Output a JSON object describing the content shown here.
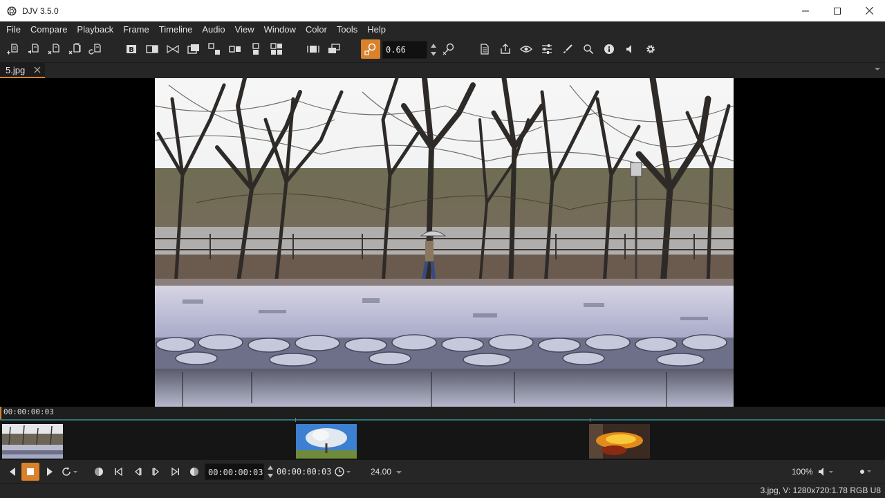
{
  "window": {
    "title": "DJV 3.5.0"
  },
  "menu": [
    "File",
    "Compare",
    "Playback",
    "Frame",
    "Timeline",
    "Audio",
    "View",
    "Window",
    "Color",
    "Tools",
    "Help"
  ],
  "toolbar": {
    "zoom_value": "0.66",
    "file_icons": [
      "file-open-icon",
      "file-open-with-audio-icon",
      "file-close-icon",
      "file-close-all-icon",
      "file-reload-icon"
    ],
    "compare_icons": [
      "compare-b-icon",
      "compare-wipe-icon",
      "compare-overlay-icon",
      "compare-difference-icon",
      "compare-horizontal-icon",
      "compare-vertical-icon",
      "compare-free-icon",
      "compare-tile-icon"
    ],
    "view_icons": [
      "frame-view-icon",
      "fit-view-icon",
      "zoom-icon",
      "zoom-reset-icon"
    ],
    "tool_icons": [
      "files-tool-icon",
      "export-icon",
      "view-tool-icon",
      "color-controls-icon",
      "annotate-icon",
      "magnify-icon",
      "info-icon",
      "audio-icon",
      "settings-icon"
    ]
  },
  "tabs": [
    {
      "label": "5.jpg",
      "active": true
    }
  ],
  "timeline": {
    "current_time": "00:00:00:03",
    "cursor_color": "#d9822b",
    "clips": [
      "winter-park-thumbnail",
      "blossom-tree-thumbnail",
      "fire-thumbnail"
    ]
  },
  "playback": {
    "current_time": "00:00:00:03",
    "duration": "00:00:00:03",
    "speed": "24.00",
    "volume": "100%"
  },
  "status": {
    "text": "3.jpg, V: 1280x720:1.78 RGB U8"
  },
  "colors": {
    "accent": "#d9822b",
    "panel": "#262626",
    "background": "#000000"
  }
}
